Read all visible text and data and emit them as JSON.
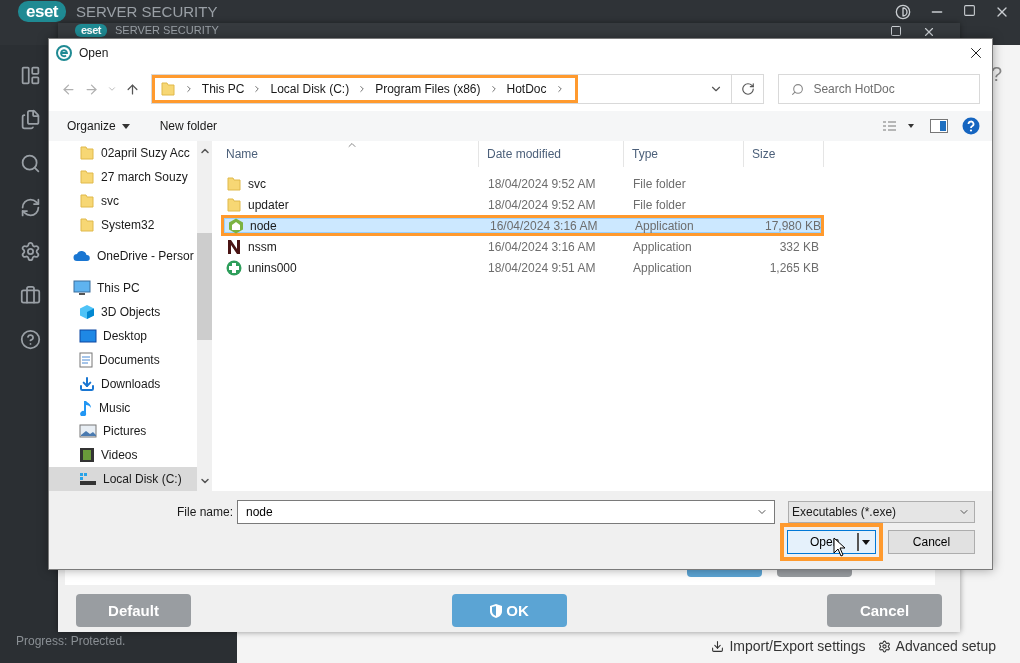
{
  "app": {
    "logo": "eset",
    "product": "SERVER SECURITY",
    "help": "?",
    "status": "Progress: Protected.",
    "footer_links": [
      {
        "label": "Import/Export settings",
        "kind": "import"
      },
      {
        "label": "Advanced setup",
        "kind": "setup"
      }
    ]
  },
  "settings_window": {
    "logo": "eset",
    "product": "SERVER SECURITY",
    "buttons": [
      {
        "label": "Default",
        "kind": "secondary"
      },
      {
        "label": "OK",
        "kind": "primary"
      },
      {
        "label": "Cancel",
        "kind": "secondary"
      }
    ]
  },
  "dialog": {
    "title": "Open",
    "breadcrumb": {
      "highlighted": true,
      "parts": [
        "This PC",
        "Local Disk (C:)",
        "Program Files (x86)",
        "HotDoc"
      ]
    },
    "search": {
      "placeholder": "Search HotDoc"
    },
    "toolbar": [
      {
        "label": "Organize",
        "kind": "menu"
      },
      {
        "label": "New folder",
        "kind": "plain"
      }
    ],
    "nav_pane": [
      {
        "label": "02april Suzy Acc",
        "kind": "folder",
        "selected": false
      },
      {
        "label": "27 march Souzy",
        "kind": "folder",
        "selected": false
      },
      {
        "label": "svc",
        "kind": "folder",
        "selected": false
      },
      {
        "label": "System32",
        "kind": "folder",
        "selected": false
      },
      {
        "label": "OneDrive - Persor",
        "kind": "cloud",
        "selected": false
      },
      {
        "label": "This PC",
        "kind": "pc",
        "selected": false,
        "children": [
          {
            "label": "3D Objects",
            "kind": "cube",
            "selected": false
          },
          {
            "label": "Desktop",
            "kind": "desktop",
            "selected": false
          },
          {
            "label": "Documents",
            "kind": "documents",
            "selected": false
          },
          {
            "label": "Downloads",
            "kind": "downloads",
            "selected": false
          },
          {
            "label": "Music",
            "kind": "music",
            "selected": false
          },
          {
            "label": "Pictures",
            "kind": "pictures",
            "selected": false
          },
          {
            "label": "Videos",
            "kind": "videos",
            "selected": false
          },
          {
            "label": "Local Disk (C:)",
            "kind": "disk",
            "selected": true
          }
        ]
      }
    ],
    "columns": [
      "Name",
      "Date modified",
      "Type",
      "Size"
    ],
    "rows": [
      {
        "name": "svc",
        "kind": "folder",
        "date": "18/04/2024 9:52 AM",
        "type": "File folder",
        "size": "",
        "selected": false,
        "highlighted": false
      },
      {
        "name": "updater",
        "kind": "folder",
        "date": "18/04/2024 9:52 AM",
        "type": "File folder",
        "size": "",
        "selected": false,
        "highlighted": false
      },
      {
        "name": "node",
        "kind": "node",
        "date": "16/04/2024 3:16 AM",
        "type": "Application",
        "size": "17,980 KB",
        "selected": true,
        "highlighted": true
      },
      {
        "name": "nssm",
        "kind": "nssm",
        "date": "16/04/2024 3:16 AM",
        "type": "Application",
        "size": "332 KB",
        "selected": false,
        "highlighted": false
      },
      {
        "name": "unins000",
        "kind": "unins",
        "date": "18/04/2024 9:51 AM",
        "type": "Application",
        "size": "1,265 KB",
        "selected": false,
        "highlighted": false
      }
    ],
    "file_name": {
      "label": "File name:",
      "value": "node"
    },
    "file_type": "Executables (*.exe)",
    "open_button": {
      "label": "Open",
      "highlighted": true
    },
    "cancel_button": "Cancel"
  }
}
